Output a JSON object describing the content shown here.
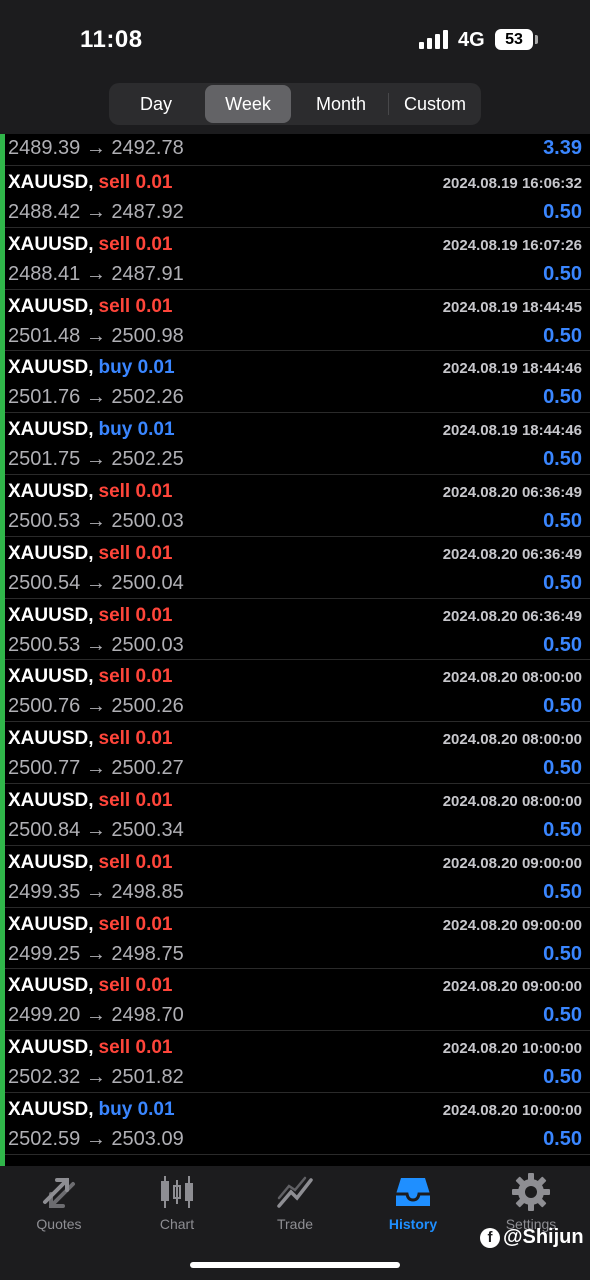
{
  "status_bar": {
    "time": "11:08",
    "network": "4G",
    "battery": "53"
  },
  "periods": [
    {
      "label": "Day",
      "active": false
    },
    {
      "label": "Week",
      "active": true
    },
    {
      "label": "Month",
      "active": false
    },
    {
      "label": "Custom",
      "active": false
    }
  ],
  "trades": [
    {
      "symbol": "",
      "action": "",
      "lot": "",
      "datetime": "",
      "open_price": "2489.39",
      "close_price": "2492.78",
      "profit": "3.39"
    },
    {
      "symbol": "XAUUSD,",
      "action": "sell",
      "lot": "0.01",
      "datetime": "2024.08.19 16:06:32",
      "open_price": "2488.42",
      "close_price": "2487.92",
      "profit": "0.50"
    },
    {
      "symbol": "XAUUSD,",
      "action": "sell",
      "lot": "0.01",
      "datetime": "2024.08.19 16:07:26",
      "open_price": "2488.41",
      "close_price": "2487.91",
      "profit": "0.50"
    },
    {
      "symbol": "XAUUSD,",
      "action": "sell",
      "lot": "0.01",
      "datetime": "2024.08.19 18:44:45",
      "open_price": "2501.48",
      "close_price": "2500.98",
      "profit": "0.50"
    },
    {
      "symbol": "XAUUSD,",
      "action": "buy",
      "lot": "0.01",
      "datetime": "2024.08.19 18:44:46",
      "open_price": "2501.76",
      "close_price": "2502.26",
      "profit": "0.50"
    },
    {
      "symbol": "XAUUSD,",
      "action": "buy",
      "lot": "0.01",
      "datetime": "2024.08.19 18:44:46",
      "open_price": "2501.75",
      "close_price": "2502.25",
      "profit": "0.50"
    },
    {
      "symbol": "XAUUSD,",
      "action": "sell",
      "lot": "0.01",
      "datetime": "2024.08.20 06:36:49",
      "open_price": "2500.53",
      "close_price": "2500.03",
      "profit": "0.50"
    },
    {
      "symbol": "XAUUSD,",
      "action": "sell",
      "lot": "0.01",
      "datetime": "2024.08.20 06:36:49",
      "open_price": "2500.54",
      "close_price": "2500.04",
      "profit": "0.50"
    },
    {
      "symbol": "XAUUSD,",
      "action": "sell",
      "lot": "0.01",
      "datetime": "2024.08.20 06:36:49",
      "open_price": "2500.53",
      "close_price": "2500.03",
      "profit": "0.50"
    },
    {
      "symbol": "XAUUSD,",
      "action": "sell",
      "lot": "0.01",
      "datetime": "2024.08.20 08:00:00",
      "open_price": "2500.76",
      "close_price": "2500.26",
      "profit": "0.50"
    },
    {
      "symbol": "XAUUSD,",
      "action": "sell",
      "lot": "0.01",
      "datetime": "2024.08.20 08:00:00",
      "open_price": "2500.77",
      "close_price": "2500.27",
      "profit": "0.50"
    },
    {
      "symbol": "XAUUSD,",
      "action": "sell",
      "lot": "0.01",
      "datetime": "2024.08.20 08:00:00",
      "open_price": "2500.84",
      "close_price": "2500.34",
      "profit": "0.50"
    },
    {
      "symbol": "XAUUSD,",
      "action": "sell",
      "lot": "0.01",
      "datetime": "2024.08.20 09:00:00",
      "open_price": "2499.35",
      "close_price": "2498.85",
      "profit": "0.50"
    },
    {
      "symbol": "XAUUSD,",
      "action": "sell",
      "lot": "0.01",
      "datetime": "2024.08.20 09:00:00",
      "open_price": "2499.25",
      "close_price": "2498.75",
      "profit": "0.50"
    },
    {
      "symbol": "XAUUSD,",
      "action": "sell",
      "lot": "0.01",
      "datetime": "2024.08.20 09:00:00",
      "open_price": "2499.20",
      "close_price": "2498.70",
      "profit": "0.50"
    },
    {
      "symbol": "XAUUSD,",
      "action": "sell",
      "lot": "0.01",
      "datetime": "2024.08.20 10:00:00",
      "open_price": "2502.32",
      "close_price": "2501.82",
      "profit": "0.50"
    },
    {
      "symbol": "XAUUSD,",
      "action": "buy",
      "lot": "0.01",
      "datetime": "2024.08.20 10:00:00",
      "open_price": "2502.59",
      "close_price": "2503.09",
      "profit": "0.50"
    }
  ],
  "tab_bar": [
    {
      "label": "Quotes",
      "icon": "quotes-arrows-icon",
      "active": false
    },
    {
      "label": "Chart",
      "icon": "candlestick-chart-icon",
      "active": false
    },
    {
      "label": "Trade",
      "icon": "trade-line-icon",
      "active": false
    },
    {
      "label": "History",
      "icon": "history-tray-icon",
      "active": true
    },
    {
      "label": "Settings",
      "icon": "gear-icon",
      "active": false
    }
  ],
  "watermark": "@Shijun",
  "arrow_glyph": "→",
  "colors": {
    "sell": "#ff453a",
    "buy": "#3a86ff",
    "profit": "#3a86ff",
    "active_tab": "#1f8fff",
    "accent_bar": "#30b64a"
  }
}
